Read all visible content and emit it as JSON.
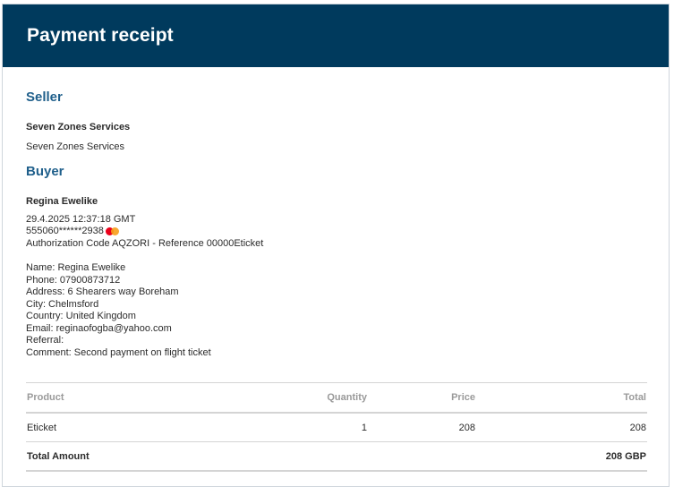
{
  "header": {
    "title": "Payment receipt"
  },
  "seller": {
    "heading": "Seller",
    "name": "Seven Zones Services",
    "subname": "Seven Zones Services"
  },
  "buyer": {
    "heading": "Buyer",
    "name": "Regina Ewelike",
    "datetime": "29.4.2025 12:37:18 GMT",
    "card_number": "555060******2938",
    "card_icon": "mastercard-icon",
    "authorization": "Authorization Code AQZORI - Reference 00000Eticket",
    "details": [
      "Name: Regina Ewelike",
      "Phone: 07900873712",
      "Address: 6 Shearers way Boreham",
      "City: Chelmsford",
      "Country: United Kingdom",
      "Email: reginaofogba@yahoo.com",
      "Referral:",
      "Comment: Second payment on flight ticket"
    ]
  },
  "table": {
    "headers": {
      "product": "Product",
      "quantity": "Quantity",
      "price": "Price",
      "total": "Total"
    },
    "rows": [
      {
        "product": "Eticket",
        "quantity": "1",
        "price": "208",
        "total": "208"
      }
    ],
    "total_label": "Total Amount",
    "total_value": "208 GBP"
  },
  "colors": {
    "header_bg": "#003a5d",
    "heading_blue": "#1f5f8b",
    "mastercard_red": "#eb001b",
    "mastercard_orange": "#f79e1b"
  }
}
